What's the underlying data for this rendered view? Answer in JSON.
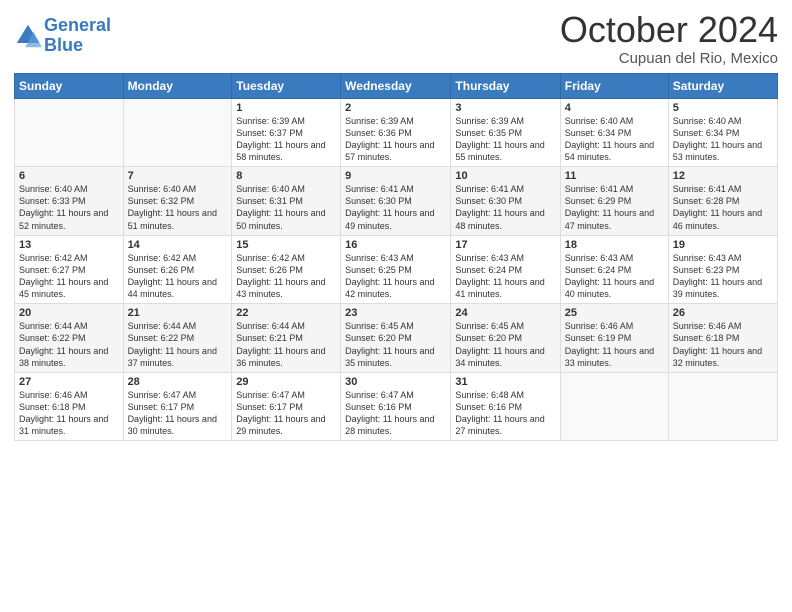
{
  "logo": {
    "line1": "General",
    "line2": "Blue"
  },
  "header": {
    "month": "October 2024",
    "location": "Cupuan del Rio, Mexico"
  },
  "weekdays": [
    "Sunday",
    "Monday",
    "Tuesday",
    "Wednesday",
    "Thursday",
    "Friday",
    "Saturday"
  ],
  "weeks": [
    [
      {
        "day": "",
        "info": ""
      },
      {
        "day": "",
        "info": ""
      },
      {
        "day": "1",
        "info": "Sunrise: 6:39 AM\nSunset: 6:37 PM\nDaylight: 11 hours and 58 minutes."
      },
      {
        "day": "2",
        "info": "Sunrise: 6:39 AM\nSunset: 6:36 PM\nDaylight: 11 hours and 57 minutes."
      },
      {
        "day": "3",
        "info": "Sunrise: 6:39 AM\nSunset: 6:35 PM\nDaylight: 11 hours and 55 minutes."
      },
      {
        "day": "4",
        "info": "Sunrise: 6:40 AM\nSunset: 6:34 PM\nDaylight: 11 hours and 54 minutes."
      },
      {
        "day": "5",
        "info": "Sunrise: 6:40 AM\nSunset: 6:34 PM\nDaylight: 11 hours and 53 minutes."
      }
    ],
    [
      {
        "day": "6",
        "info": "Sunrise: 6:40 AM\nSunset: 6:33 PM\nDaylight: 11 hours and 52 minutes."
      },
      {
        "day": "7",
        "info": "Sunrise: 6:40 AM\nSunset: 6:32 PM\nDaylight: 11 hours and 51 minutes."
      },
      {
        "day": "8",
        "info": "Sunrise: 6:40 AM\nSunset: 6:31 PM\nDaylight: 11 hours and 50 minutes."
      },
      {
        "day": "9",
        "info": "Sunrise: 6:41 AM\nSunset: 6:30 PM\nDaylight: 11 hours and 49 minutes."
      },
      {
        "day": "10",
        "info": "Sunrise: 6:41 AM\nSunset: 6:30 PM\nDaylight: 11 hours and 48 minutes."
      },
      {
        "day": "11",
        "info": "Sunrise: 6:41 AM\nSunset: 6:29 PM\nDaylight: 11 hours and 47 minutes."
      },
      {
        "day": "12",
        "info": "Sunrise: 6:41 AM\nSunset: 6:28 PM\nDaylight: 11 hours and 46 minutes."
      }
    ],
    [
      {
        "day": "13",
        "info": "Sunrise: 6:42 AM\nSunset: 6:27 PM\nDaylight: 11 hours and 45 minutes."
      },
      {
        "day": "14",
        "info": "Sunrise: 6:42 AM\nSunset: 6:26 PM\nDaylight: 11 hours and 44 minutes."
      },
      {
        "day": "15",
        "info": "Sunrise: 6:42 AM\nSunset: 6:26 PM\nDaylight: 11 hours and 43 minutes."
      },
      {
        "day": "16",
        "info": "Sunrise: 6:43 AM\nSunset: 6:25 PM\nDaylight: 11 hours and 42 minutes."
      },
      {
        "day": "17",
        "info": "Sunrise: 6:43 AM\nSunset: 6:24 PM\nDaylight: 11 hours and 41 minutes."
      },
      {
        "day": "18",
        "info": "Sunrise: 6:43 AM\nSunset: 6:24 PM\nDaylight: 11 hours and 40 minutes."
      },
      {
        "day": "19",
        "info": "Sunrise: 6:43 AM\nSunset: 6:23 PM\nDaylight: 11 hours and 39 minutes."
      }
    ],
    [
      {
        "day": "20",
        "info": "Sunrise: 6:44 AM\nSunset: 6:22 PM\nDaylight: 11 hours and 38 minutes."
      },
      {
        "day": "21",
        "info": "Sunrise: 6:44 AM\nSunset: 6:22 PM\nDaylight: 11 hours and 37 minutes."
      },
      {
        "day": "22",
        "info": "Sunrise: 6:44 AM\nSunset: 6:21 PM\nDaylight: 11 hours and 36 minutes."
      },
      {
        "day": "23",
        "info": "Sunrise: 6:45 AM\nSunset: 6:20 PM\nDaylight: 11 hours and 35 minutes."
      },
      {
        "day": "24",
        "info": "Sunrise: 6:45 AM\nSunset: 6:20 PM\nDaylight: 11 hours and 34 minutes."
      },
      {
        "day": "25",
        "info": "Sunrise: 6:46 AM\nSunset: 6:19 PM\nDaylight: 11 hours and 33 minutes."
      },
      {
        "day": "26",
        "info": "Sunrise: 6:46 AM\nSunset: 6:18 PM\nDaylight: 11 hours and 32 minutes."
      }
    ],
    [
      {
        "day": "27",
        "info": "Sunrise: 6:46 AM\nSunset: 6:18 PM\nDaylight: 11 hours and 31 minutes."
      },
      {
        "day": "28",
        "info": "Sunrise: 6:47 AM\nSunset: 6:17 PM\nDaylight: 11 hours and 30 minutes."
      },
      {
        "day": "29",
        "info": "Sunrise: 6:47 AM\nSunset: 6:17 PM\nDaylight: 11 hours and 29 minutes."
      },
      {
        "day": "30",
        "info": "Sunrise: 6:47 AM\nSunset: 6:16 PM\nDaylight: 11 hours and 28 minutes."
      },
      {
        "day": "31",
        "info": "Sunrise: 6:48 AM\nSunset: 6:16 PM\nDaylight: 11 hours and 27 minutes."
      },
      {
        "day": "",
        "info": ""
      },
      {
        "day": "",
        "info": ""
      }
    ]
  ]
}
